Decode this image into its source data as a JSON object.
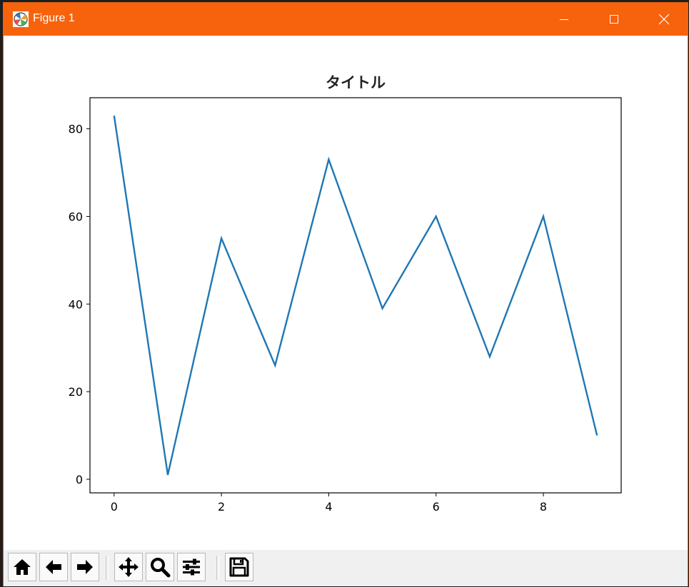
{
  "window": {
    "title": "Figure 1",
    "accent_color": "#f7630c",
    "icon": "matplotlib-figure-icon",
    "controls": {
      "minimize_icon": "minimize-icon",
      "maximize_icon": "maximize-icon",
      "close_icon": "close-icon"
    }
  },
  "toolbar": {
    "buttons": [
      {
        "name": "home-button",
        "icon": "home-icon"
      },
      {
        "name": "back-button",
        "icon": "arrow-left-icon"
      },
      {
        "name": "forward-button",
        "icon": "arrow-right-icon"
      },
      {
        "name": "pan-button",
        "icon": "move-icon"
      },
      {
        "name": "zoom-button",
        "icon": "search-icon"
      },
      {
        "name": "configure-subplots-button",
        "icon": "sliders-icon"
      },
      {
        "name": "save-button",
        "icon": "save-icon"
      }
    ]
  },
  "chart_data": {
    "type": "line",
    "title": "タイトル",
    "xlabel": "",
    "ylabel": "",
    "x": [
      0,
      1,
      2,
      3,
      4,
      5,
      6,
      7,
      8,
      9
    ],
    "series": [
      {
        "values": [
          83,
          1,
          55,
          26,
          73,
          39,
          60,
          28,
          60,
          10
        ],
        "color": "#1f77b4"
      }
    ],
    "xticks": [
      "0",
      "2",
      "4",
      "6",
      "8"
    ],
    "yticks": [
      "0",
      "20",
      "40",
      "60",
      "80"
    ],
    "xlim": [
      -0.45,
      9.45
    ],
    "ylim": [
      -3.1,
      87.1
    ],
    "grid": false,
    "legend": "none"
  }
}
